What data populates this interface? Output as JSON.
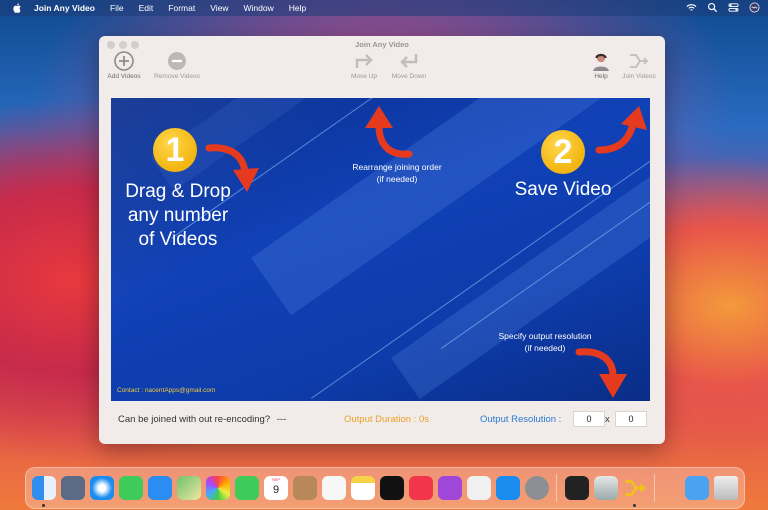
{
  "menubar": {
    "app_name": "Join Any Video",
    "items": [
      "File",
      "Edit",
      "Format",
      "View",
      "Window",
      "Help"
    ]
  },
  "window": {
    "title": "Join Any Video"
  },
  "toolbar": {
    "add_videos": "Add Videos",
    "remove_videos": "Remove Videos",
    "move_up": "Move Up",
    "move_down": "Move Down",
    "help": "Help",
    "join_videos": "Join Videos"
  },
  "canvas": {
    "step1_number": "1",
    "step1_line1": "Drag & Drop",
    "step1_line2": "any number",
    "step1_line3": "of Videos",
    "step2_number": "2",
    "step2_text": "Save Video",
    "rearrange_line1": "Rearrange joining order",
    "rearrange_line2": "(if needed)",
    "resolution_line1": "Specify output resolution",
    "resolution_line2": "(if needed)",
    "contact": "Contact : nacentApps@gmail.com"
  },
  "status": {
    "reencode_label": "Can be joined with out re-encoding?",
    "reencode_value": "---",
    "duration": "Output Duration : 0s",
    "resolution_label": "Output Resolution :",
    "width": "0",
    "separator": "x",
    "height": "0"
  },
  "dock": {
    "calendar_month": "SEP",
    "calendar_day": "9"
  },
  "colors": {
    "accent_blue": "#2a7ad6",
    "duration_orange": "#f0a02a",
    "badge_yellow": "#f2b40f",
    "arrow_red": "#e63a1e"
  }
}
